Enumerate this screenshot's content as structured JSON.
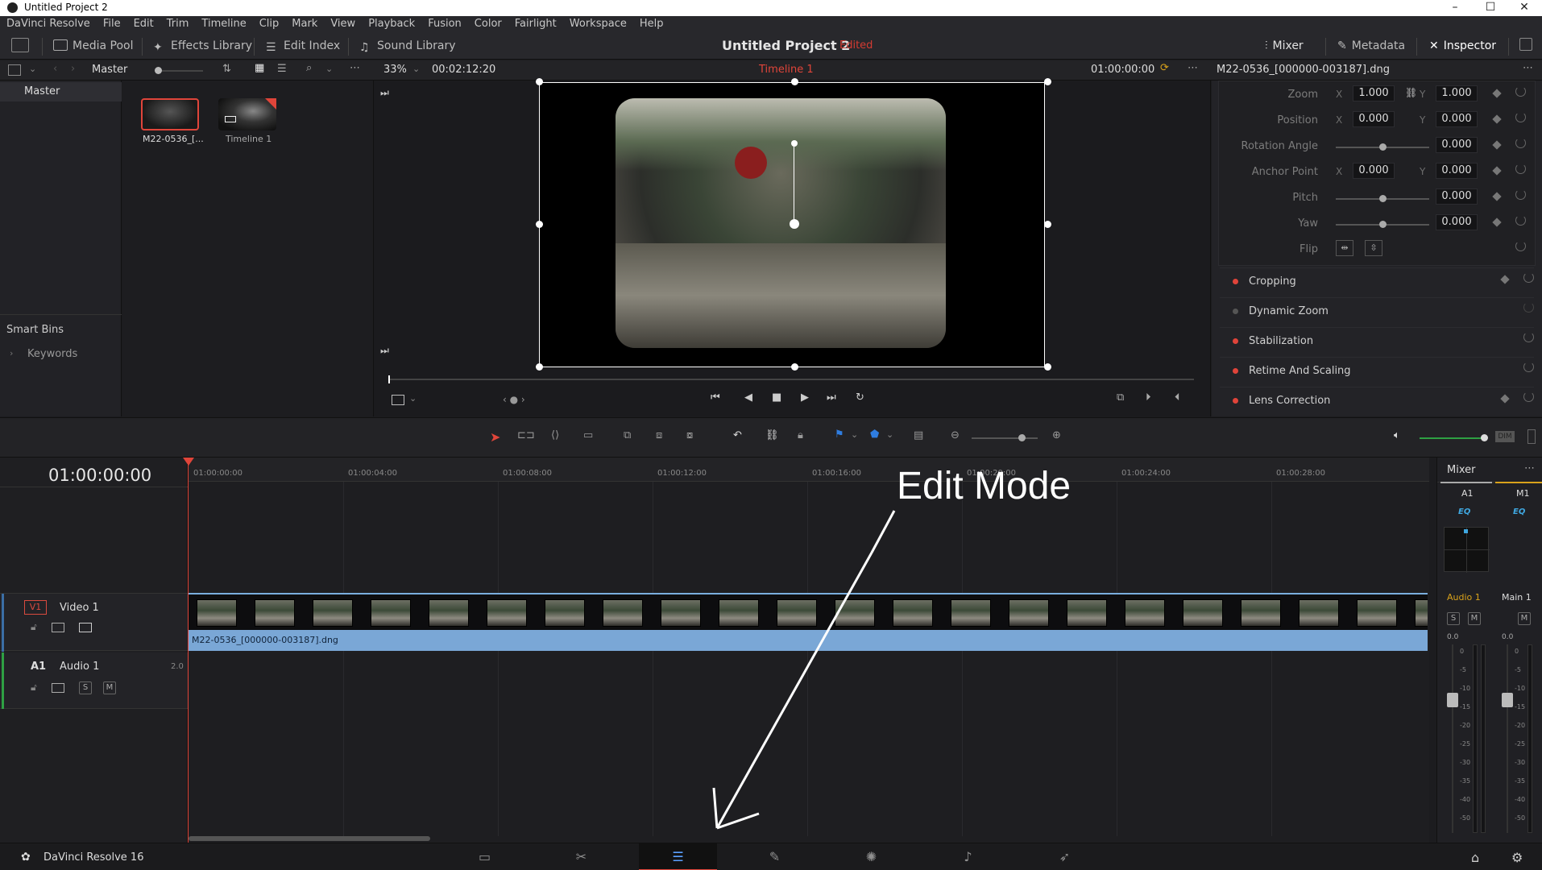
{
  "window": {
    "title": "Untitled Project 2",
    "controls": [
      "–",
      "☐",
      "✕"
    ]
  },
  "menu": [
    "DaVinci Resolve",
    "File",
    "Edit",
    "Trim",
    "Timeline",
    "Clip",
    "Mark",
    "View",
    "Playback",
    "Fusion",
    "Color",
    "Fairlight",
    "Workspace",
    "Help"
  ],
  "toolbar": {
    "media_pool": "Media Pool",
    "effects_library": "Effects Library",
    "edit_index": "Edit Index",
    "sound_library": "Sound Library",
    "project_title": "Untitled Project 2",
    "edited": "Edited",
    "mixer": "Mixer",
    "metadata": "Metadata",
    "inspector": "Inspector"
  },
  "subbar": {
    "bin_name": "Master",
    "zoom": "33%",
    "duration": "00:02:12:20",
    "timeline_name": "Timeline 1",
    "viewer_timecode": "01:00:00:00",
    "clip_name": "M22-0536_[000000-003187].dng"
  },
  "bins": {
    "master": "Master",
    "smart_bins": "Smart Bins",
    "keywords": "Keywords"
  },
  "pool": {
    "items": [
      "M22-0536_[...",
      "Timeline 1"
    ]
  },
  "inspector": {
    "zoom": {
      "label": "Zoom",
      "x": "1.000",
      "y": "1.000"
    },
    "position": {
      "label": "Position",
      "x": "0.000",
      "y": "0.000"
    },
    "rotation": {
      "label": "Rotation Angle",
      "value": "0.000",
      "slider": 0.5
    },
    "anchor": {
      "label": "Anchor Point",
      "x": "0.000",
      "y": "0.000"
    },
    "pitch": {
      "label": "Pitch",
      "value": "0.000",
      "slider": 0.5
    },
    "yaw": {
      "label": "Yaw",
      "value": "0.000",
      "slider": 0.5
    },
    "flip": {
      "label": "Flip"
    },
    "axis_x": "X",
    "axis_y": "Y",
    "sections": [
      {
        "name": "Cropping",
        "enabled": true
      },
      {
        "name": "Dynamic Zoom",
        "enabled": false
      },
      {
        "name": "Stabilization",
        "enabled": true
      },
      {
        "name": "Retime And Scaling",
        "enabled": true
      },
      {
        "name": "Lens Correction",
        "enabled": true
      }
    ]
  },
  "timeline": {
    "timecode": "01:00:00:00",
    "ruler": [
      "01:00:00:00",
      "01:00:04:00",
      "01:00:08:00",
      "01:00:12:00",
      "01:00:16:00",
      "01:00:20:00",
      "01:00:24:00",
      "01:00:28:00"
    ],
    "video_track": {
      "id": "V1",
      "name": "Video 1"
    },
    "audio_track": {
      "id": "A1",
      "name": "Audio 1",
      "channels": "2.0"
    },
    "clip_name": "M22-0536_[000000-003187].dng",
    "annotation": "Edit Mode"
  },
  "mixer": {
    "title": "Mixer",
    "ch1": "A1",
    "ch2": "M1",
    "eq": "EQ",
    "name1": "Audio 1",
    "name2": "Main 1",
    "s": "S",
    "m": "M",
    "level1": "0.0",
    "level2": "0.0",
    "scale": [
      "0",
      "-5",
      "-10",
      "-15",
      "-20",
      "-25",
      "-30",
      "-35",
      "-40",
      "-50"
    ]
  },
  "pages": {
    "app_name": "DaVinci Resolve 16",
    "active": "edit"
  }
}
